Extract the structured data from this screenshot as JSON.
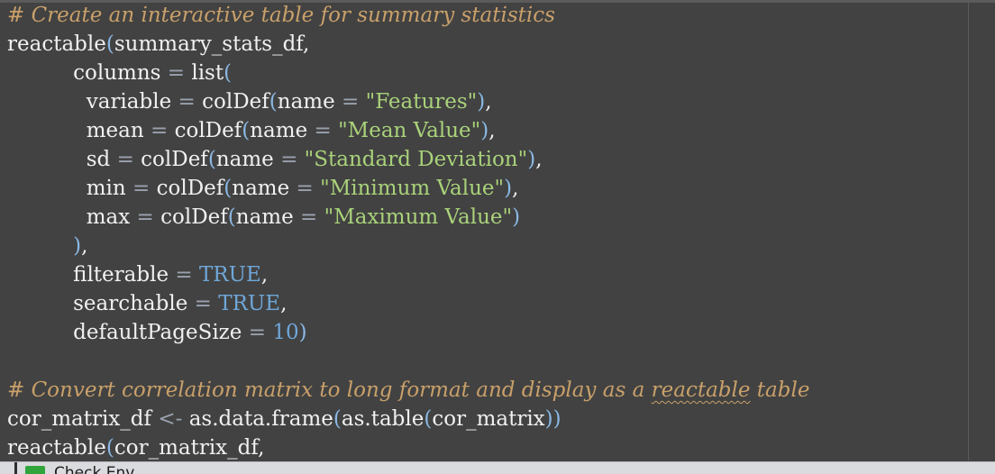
{
  "editor": {
    "lines": [
      {
        "parts": [
          {
            "t": "# Create an interactive table for summary statistics",
            "c": "comment"
          }
        ]
      },
      {
        "parts": [
          {
            "t": "reactable",
            "c": ""
          },
          {
            "t": "(",
            "c": "punc"
          },
          {
            "t": "summary_stats_df,",
            "c": ""
          }
        ]
      },
      {
        "parts": [
          {
            "t": "          columns ",
            "c": ""
          },
          {
            "t": "=",
            "c": "op"
          },
          {
            "t": " list",
            "c": ""
          },
          {
            "t": "(",
            "c": "punc"
          }
        ]
      },
      {
        "parts": [
          {
            "t": "            variable ",
            "c": ""
          },
          {
            "t": "=",
            "c": "op"
          },
          {
            "t": " colDef",
            "c": ""
          },
          {
            "t": "(",
            "c": "punc"
          },
          {
            "t": "name ",
            "c": ""
          },
          {
            "t": "=",
            "c": "op"
          },
          {
            "t": " ",
            "c": ""
          },
          {
            "t": "\"Features\"",
            "c": "str"
          },
          {
            "t": ")",
            "c": "punc"
          },
          {
            "t": ",",
            "c": ""
          }
        ]
      },
      {
        "parts": [
          {
            "t": "            mean ",
            "c": ""
          },
          {
            "t": "=",
            "c": "op"
          },
          {
            "t": " colDef",
            "c": ""
          },
          {
            "t": "(",
            "c": "punc"
          },
          {
            "t": "name ",
            "c": ""
          },
          {
            "t": "=",
            "c": "op"
          },
          {
            "t": " ",
            "c": ""
          },
          {
            "t": "\"Mean Value\"",
            "c": "str"
          },
          {
            "t": ")",
            "c": "punc"
          },
          {
            "t": ",",
            "c": ""
          }
        ]
      },
      {
        "parts": [
          {
            "t": "            sd ",
            "c": ""
          },
          {
            "t": "=",
            "c": "op"
          },
          {
            "t": " colDef",
            "c": ""
          },
          {
            "t": "(",
            "c": "punc"
          },
          {
            "t": "name ",
            "c": ""
          },
          {
            "t": "=",
            "c": "op"
          },
          {
            "t": " ",
            "c": ""
          },
          {
            "t": "\"Standard Deviation\"",
            "c": "str"
          },
          {
            "t": ")",
            "c": "punc"
          },
          {
            "t": ",",
            "c": ""
          }
        ]
      },
      {
        "parts": [
          {
            "t": "            min ",
            "c": ""
          },
          {
            "t": "=",
            "c": "op"
          },
          {
            "t": " colDef",
            "c": ""
          },
          {
            "t": "(",
            "c": "punc"
          },
          {
            "t": "name ",
            "c": ""
          },
          {
            "t": "=",
            "c": "op"
          },
          {
            "t": " ",
            "c": ""
          },
          {
            "t": "\"Minimum Value\"",
            "c": "str"
          },
          {
            "t": ")",
            "c": "punc"
          },
          {
            "t": ",",
            "c": ""
          }
        ]
      },
      {
        "parts": [
          {
            "t": "            max ",
            "c": ""
          },
          {
            "t": "=",
            "c": "op"
          },
          {
            "t": " colDef",
            "c": ""
          },
          {
            "t": "(",
            "c": "punc"
          },
          {
            "t": "name ",
            "c": ""
          },
          {
            "t": "=",
            "c": "op"
          },
          {
            "t": " ",
            "c": ""
          },
          {
            "t": "\"Maximum Value\"",
            "c": "str"
          },
          {
            "t": ")",
            "c": "punc"
          }
        ]
      },
      {
        "parts": [
          {
            "t": "          ",
            "c": ""
          },
          {
            "t": ")",
            "c": "punc"
          },
          {
            "t": ",",
            "c": ""
          }
        ]
      },
      {
        "parts": [
          {
            "t": "          filterable ",
            "c": ""
          },
          {
            "t": "=",
            "c": "op"
          },
          {
            "t": " ",
            "c": ""
          },
          {
            "t": "TRUE",
            "c": "num"
          },
          {
            "t": ",",
            "c": ""
          }
        ]
      },
      {
        "parts": [
          {
            "t": "          searchable ",
            "c": ""
          },
          {
            "t": "=",
            "c": "op"
          },
          {
            "t": " ",
            "c": ""
          },
          {
            "t": "TRUE",
            "c": "num"
          },
          {
            "t": ",",
            "c": ""
          }
        ]
      },
      {
        "parts": [
          {
            "t": "          defaultPageSize ",
            "c": ""
          },
          {
            "t": "=",
            "c": "op"
          },
          {
            "t": " ",
            "c": ""
          },
          {
            "t": "10",
            "c": "num"
          },
          {
            "t": ")",
            "c": "punc"
          }
        ]
      },
      {
        "parts": []
      },
      {
        "parts": [
          {
            "t": "# Convert correlation matrix to long format and display as a ",
            "c": "comment"
          },
          {
            "t": "reactable",
            "c": "comment squiggle"
          },
          {
            "t": " table",
            "c": "comment"
          }
        ]
      },
      {
        "parts": [
          {
            "t": "cor_matrix_df ",
            "c": ""
          },
          {
            "t": "<-",
            "c": "op"
          },
          {
            "t": " as.data.frame",
            "c": ""
          },
          {
            "t": "(",
            "c": "punc"
          },
          {
            "t": "as.table",
            "c": ""
          },
          {
            "t": "(",
            "c": "punc"
          },
          {
            "t": "cor_matrix",
            "c": ""
          },
          {
            "t": "))",
            "c": "punc"
          }
        ]
      },
      {
        "parts": [
          {
            "t": "reactable",
            "c": ""
          },
          {
            "t": "(",
            "c": "punc"
          },
          {
            "t": "cor_matrix_df,",
            "c": ""
          }
        ]
      }
    ]
  },
  "status": {
    "label": "Check Env"
  },
  "colors": {
    "background": "#424242",
    "comment": "#c9a06a",
    "string": "#a9d27a",
    "number": "#6fa7d8",
    "bracket": "#8ab8e4"
  }
}
